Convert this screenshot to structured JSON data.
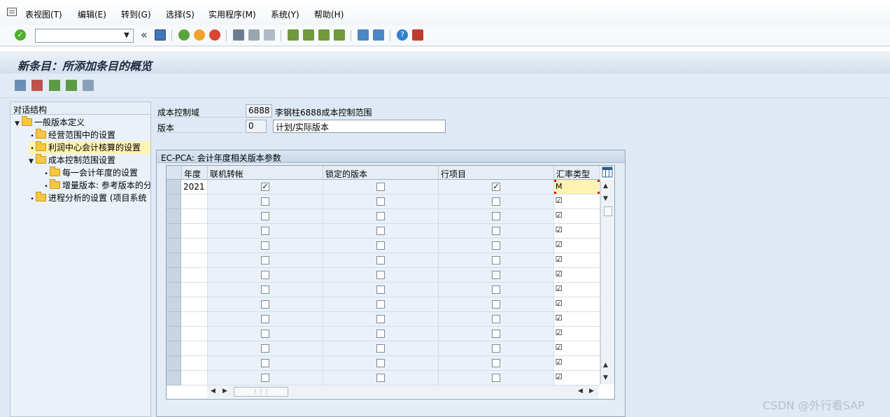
{
  "menubar": {
    "items": [
      "表视图(T)",
      "编辑(E)",
      "转到(G)",
      "选择(S)",
      "实用程序(M)",
      "系统(Y)",
      "帮助(H)"
    ]
  },
  "toolbar": {
    "command_field_value": "",
    "icons": [
      "enter-icon",
      "save-icon",
      "back-icon",
      "exit-icon",
      "cancel-icon",
      "print-icon",
      "find-icon",
      "find-next-icon",
      "first-page-icon",
      "prev-page-icon",
      "next-page-icon",
      "last-page-icon",
      "new-session-icon",
      "shortcut-icon",
      "help-icon",
      "layout-icon"
    ]
  },
  "title": "新条目：所添加条目的概览",
  "tree": {
    "header": "对话结构",
    "items": [
      {
        "label": "一般版本定义",
        "level": 0,
        "expanded": true
      },
      {
        "label": "经营范围中的设置",
        "level": 1
      },
      {
        "label": "利润中心会计核算的设置",
        "level": 1,
        "selected": true
      },
      {
        "label": "成本控制范围设置",
        "level": 1,
        "expanded": true
      },
      {
        "label": "每一会计年度的设置",
        "level": 2
      },
      {
        "label": "增量版本: 参考版本的分",
        "level": 2
      },
      {
        "label": "进程分析的设置 (项目系统",
        "level": 1
      }
    ]
  },
  "header_fields": {
    "controlling_area": {
      "label": "成本控制域",
      "value": "6888",
      "description": "李钢柱6888成本控制范围"
    },
    "version": {
      "label": "版本",
      "value": "0",
      "description": "计划/实际版本"
    }
  },
  "group": {
    "title": "EC-PCA: 会计年度相关版本参数"
  },
  "table": {
    "columns": [
      "年度",
      "联机转帐",
      "锁定的版本",
      "行项目",
      "汇率类型"
    ],
    "rows": [
      {
        "year": "2021",
        "online": true,
        "locked": false,
        "line_items": true,
        "fx": "M"
      },
      {
        "year": "",
        "online": false,
        "locked": false,
        "line_items": false,
        "fx": ""
      },
      {
        "year": "",
        "online": false,
        "locked": false,
        "line_items": false,
        "fx": ""
      },
      {
        "year": "",
        "online": false,
        "locked": false,
        "line_items": false,
        "fx": ""
      },
      {
        "year": "",
        "online": false,
        "locked": false,
        "line_items": false,
        "fx": ""
      },
      {
        "year": "",
        "online": false,
        "locked": false,
        "line_items": false,
        "fx": ""
      },
      {
        "year": "",
        "online": false,
        "locked": false,
        "line_items": false,
        "fx": ""
      },
      {
        "year": "",
        "online": false,
        "locked": false,
        "line_items": false,
        "fx": ""
      },
      {
        "year": "",
        "online": false,
        "locked": false,
        "line_items": false,
        "fx": ""
      },
      {
        "year": "",
        "online": false,
        "locked": false,
        "line_items": false,
        "fx": ""
      },
      {
        "year": "",
        "online": false,
        "locked": false,
        "line_items": false,
        "fx": ""
      },
      {
        "year": "",
        "online": false,
        "locked": false,
        "line_items": false,
        "fx": ""
      },
      {
        "year": "",
        "online": false,
        "locked": false,
        "line_items": false,
        "fx": ""
      },
      {
        "year": "",
        "online": false,
        "locked": false,
        "line_items": false,
        "fx": ""
      }
    ]
  },
  "watermark": "CSDN @外行看SAP",
  "colors": {
    "title_text": "#1a2a40",
    "selected_tree_item": "#fff3b3",
    "active_cell": "#fff3b3"
  }
}
